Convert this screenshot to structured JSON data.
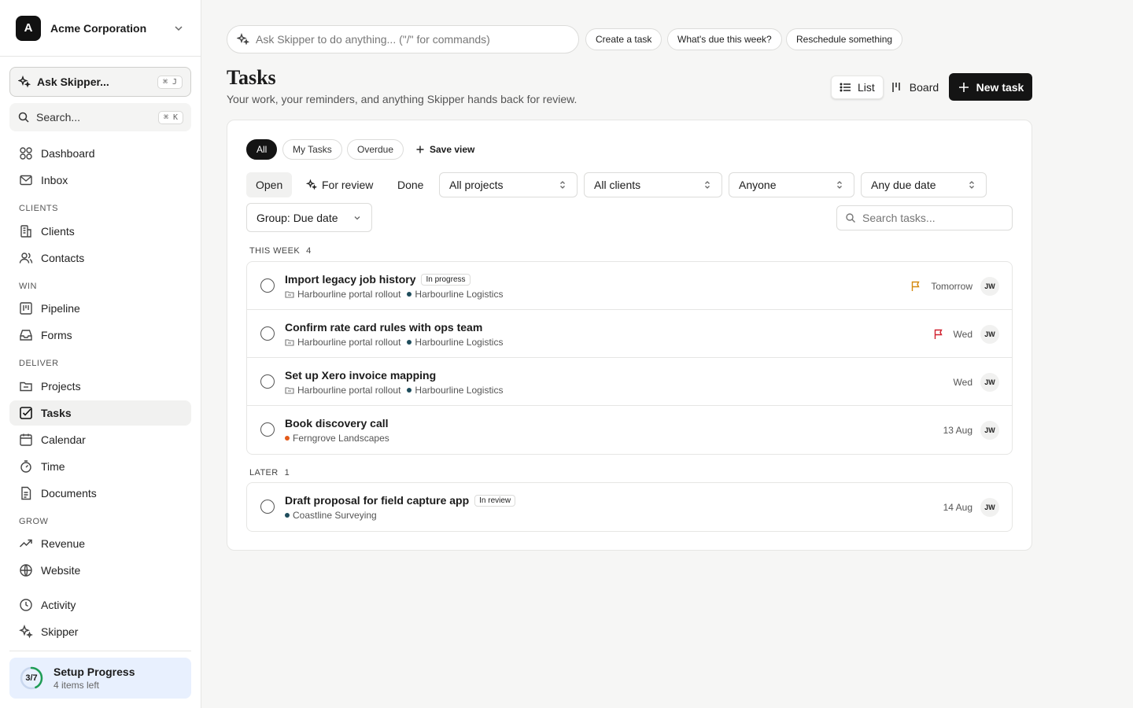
{
  "org": {
    "initial": "A",
    "name": "Acme Corporation"
  },
  "sidebar": {
    "ask": {
      "label": "Ask Skipper...",
      "shortcut": "⌘ J"
    },
    "search": {
      "label": "Search...",
      "shortcut": "⌘ K"
    },
    "items": {
      "dashboard": "Dashboard",
      "inbox": "Inbox",
      "clients": "Clients",
      "contacts": "Contacts",
      "pipeline": "Pipeline",
      "forms": "Forms",
      "projects": "Projects",
      "tasks": "Tasks",
      "calendar": "Calendar",
      "time": "Time",
      "documents": "Documents",
      "revenue": "Revenue",
      "website": "Website",
      "activity": "Activity",
      "skipper": "Skipper"
    },
    "sections": {
      "clients": "CLIENTS",
      "win": "WIN",
      "deliver": "DELIVER",
      "grow": "GROW"
    },
    "setup": {
      "ratio": "3/7",
      "progress": 0.4286,
      "title": "Setup Progress",
      "subtitle": "4 items left"
    }
  },
  "command": {
    "placeholder": "Ask Skipper to do anything... (\"/\" for commands)",
    "chips": [
      "Create a task",
      "What's due this week?",
      "Reschedule something"
    ]
  },
  "page": {
    "title": "Tasks",
    "subtitle": "Your work, your reminders, and anything Skipper hands back for review.",
    "view_list": "List",
    "view_board": "Board",
    "new_task": "New task"
  },
  "filters": {
    "views": [
      "All",
      "My Tasks",
      "Overdue"
    ],
    "save_view": "Save view",
    "status_tabs": [
      "Open",
      "For review",
      "Done"
    ],
    "projects": "All projects",
    "clients": "All clients",
    "assignee": "Anyone",
    "due": "Any due date",
    "group": "Group: Due date",
    "search_placeholder": "Search tasks..."
  },
  "groups": [
    {
      "label": "THIS WEEK",
      "count": "4",
      "tasks": [
        {
          "title": "Import legacy job history",
          "badge": "In progress",
          "project": "Harbourline portal rollout",
          "client": "Harbourline Logistics",
          "client_color": "#1f4d5c",
          "flag": "#d4890f",
          "due": "Tomorrow",
          "assignee": "JW"
        },
        {
          "title": "Confirm rate card rules with ops team",
          "badge": "",
          "project": "Harbourline portal rollout",
          "client": "Harbourline Logistics",
          "client_color": "#1f4d5c",
          "flag": "#d0202e",
          "due": "Wed",
          "assignee": "JW"
        },
        {
          "title": "Set up Xero invoice mapping",
          "badge": "",
          "project": "Harbourline portal rollout",
          "client": "Harbourline Logistics",
          "client_color": "#1f4d5c",
          "flag": "",
          "due": "Wed",
          "assignee": "JW"
        },
        {
          "title": "Book discovery call",
          "badge": "",
          "project": "",
          "client": "Ferngrove Landscapes",
          "client_color": "#e35a1a",
          "flag": "",
          "due": "13 Aug",
          "assignee": "JW"
        }
      ]
    },
    {
      "label": "LATER",
      "count": "1",
      "tasks": [
        {
          "title": "Draft proposal for field capture app",
          "badge": "In review",
          "project": "",
          "client": "Coastline Surveying",
          "client_color": "#1f4d5c",
          "flag": "",
          "due": "14 Aug",
          "assignee": "JW"
        }
      ]
    }
  ]
}
